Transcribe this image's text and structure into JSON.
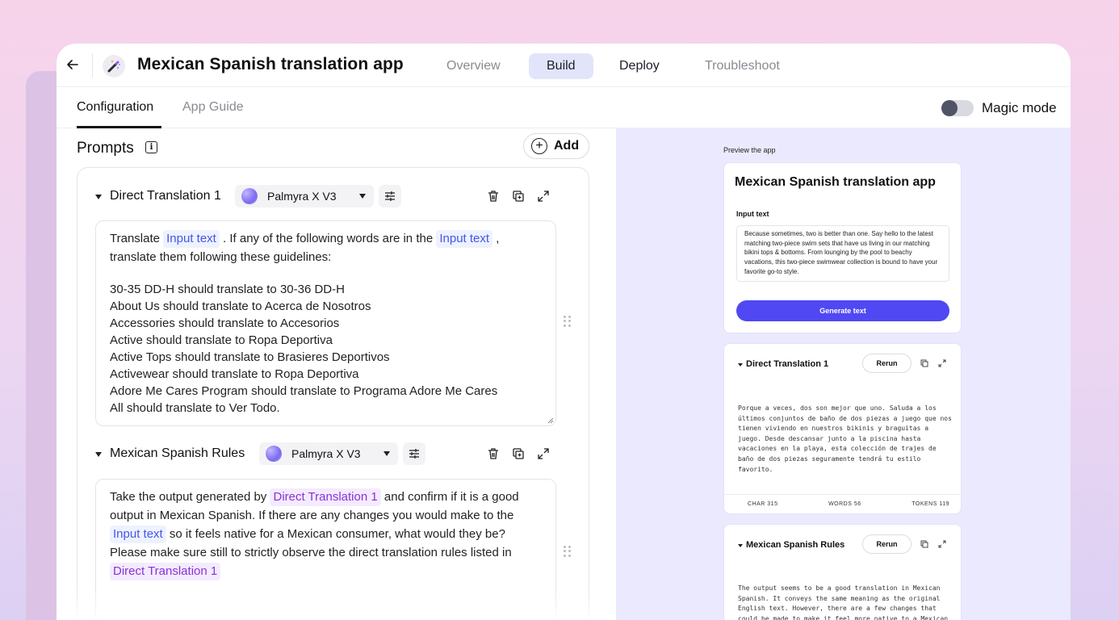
{
  "app": {
    "title": "Mexican Spanish translation app"
  },
  "nav": {
    "tabs": [
      {
        "label": "Overview"
      },
      {
        "label": "Build"
      },
      {
        "label": "Deploy"
      },
      {
        "label": "Troubleshoot"
      }
    ],
    "active_tab": "Build"
  },
  "subnav": {
    "tabs": [
      {
        "label": "Configuration"
      },
      {
        "label": "App Guide"
      }
    ],
    "active_tab": "Configuration",
    "magic_mode_label": "Magic mode",
    "magic_mode_on": false
  },
  "prompts": {
    "title": "Prompts",
    "add_label": "Add",
    "blocks": [
      {
        "title": "Direct Translation 1",
        "model": "Palmyra X V3",
        "text_parts": {
          "t1": "Translate ",
          "chip1": "Input text",
          "t2": " . If any of the following words are in the ",
          "chip2": "Input text",
          "t3": " ,",
          "t4": "translate them following these guidelines:"
        },
        "rules": [
          "30-35 DD-H should translate to 30-36 DD-H",
          "About Us should translate to Acerca de Nosotros",
          "Accessories should translate to Accesorios",
          "Active should translate to Ropa Deportiva",
          "Active Tops should translate to Brasieres Deportivos",
          "Activewear should translate to Ropa Deportiva",
          "Adore Me Cares Program should translate to Programa Adore Me Cares",
          "All should translate to Ver Todo."
        ]
      },
      {
        "title": "Mexican Spanish Rules",
        "model": "Palmyra X V3",
        "text_parts": {
          "t1": "Take the output generated by ",
          "chip1": "Direct Translation 1",
          "t2": " and confirm if it is a good output in Mexican Spanish. If there are any changes you would make to the ",
          "chip2": "Input text",
          "t3": " so it feels native for a Mexican consumer, what would they be? Please make sure still to strictly observe the direct translation rules listed in ",
          "chip3": "Direct Translation 1"
        }
      }
    ]
  },
  "preview": {
    "label": "Preview the app",
    "app_title": "Mexican Spanish translation app",
    "input_label": "Input text",
    "input_value": "Because sometimes, two is better than one. Say hello to the latest matching two-piece swim sets that have us living in our matching bikini tops & bottoms. From lounging by the pool to beachy vacations, this two-piece swimwear collection is bound to have your favorite go-to style.",
    "generate_label": "Generate text",
    "outputs": [
      {
        "title": "Direct Translation 1",
        "rerun_label": "Rerun",
        "text": "Porque a veces, dos son mejor que uno. Saluda a los últimos conjuntos de baño de dos piezas a juego que nos tienen viviendo en nuestros bikinis y braguitas a juego. Desde descansar junto a la piscina hasta vacaciones en la playa, esta colección de trajes de baño de dos piezas seguramente tendrá tu estilo favorito.",
        "stats": {
          "chars": "CHAR 315",
          "words": "WORDS 56",
          "tokens": "TOKENS 119"
        }
      },
      {
        "title": "Mexican Spanish Rules",
        "rerun_label": "Rerun",
        "text": "The output seems to be a good translation in Mexican Spanish. It conveys the same meaning as the original English text. However, there are a few changes that could be made to make it feel more native to a Mexican"
      }
    ]
  },
  "colors": {
    "accent": "#5048f2",
    "chip_blue": "#4356e8",
    "chip_purple": "#8a32d6",
    "preview_bg": "#ebe9fd"
  }
}
